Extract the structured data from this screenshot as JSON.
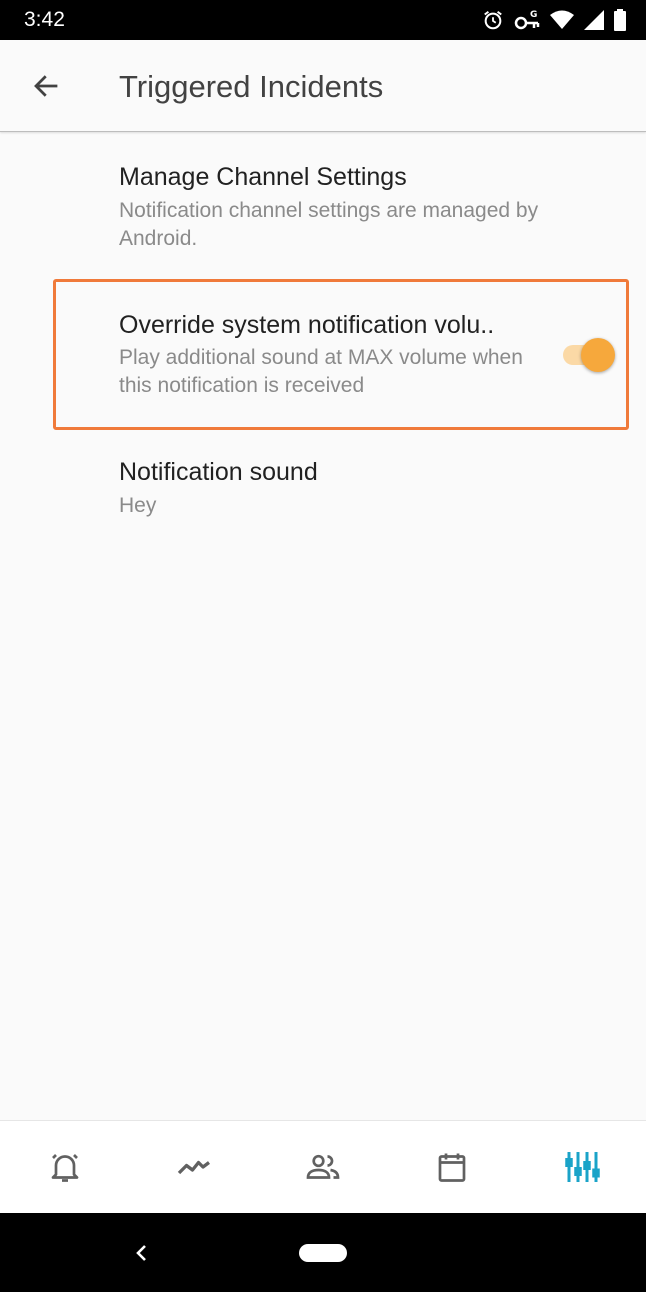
{
  "status_bar": {
    "time": "3:42",
    "icons": [
      "alarm-icon",
      "vpn-key-icon",
      "wifi-icon",
      "signal-icon",
      "battery-icon"
    ]
  },
  "app_bar": {
    "back_icon": "arrow-left-icon",
    "title": "Triggered Incidents"
  },
  "preferences": [
    {
      "title": "Manage Channel Settings",
      "summary": "Notification channel settings are managed by Android."
    },
    {
      "title": "Override system notification volu..",
      "summary": "Play additional sound at MAX volume when this notification is received",
      "toggle_on": true
    },
    {
      "title": "Notification sound",
      "summary": "Hey"
    }
  ],
  "colors": {
    "accent": "#f6a83c",
    "accent_track": "#fbd9a6",
    "highlight": "#f07a3a",
    "nav_active": "#1aa3c8",
    "nav_inactive": "#616161"
  },
  "bottom_nav": {
    "tabs": [
      {
        "icon": "alarm-bell-icon",
        "active": false
      },
      {
        "icon": "trend-line-icon",
        "active": false
      },
      {
        "icon": "people-icon",
        "active": false
      },
      {
        "icon": "calendar-icon",
        "active": false
      },
      {
        "icon": "settings-sliders-icon",
        "active": true
      }
    ]
  }
}
